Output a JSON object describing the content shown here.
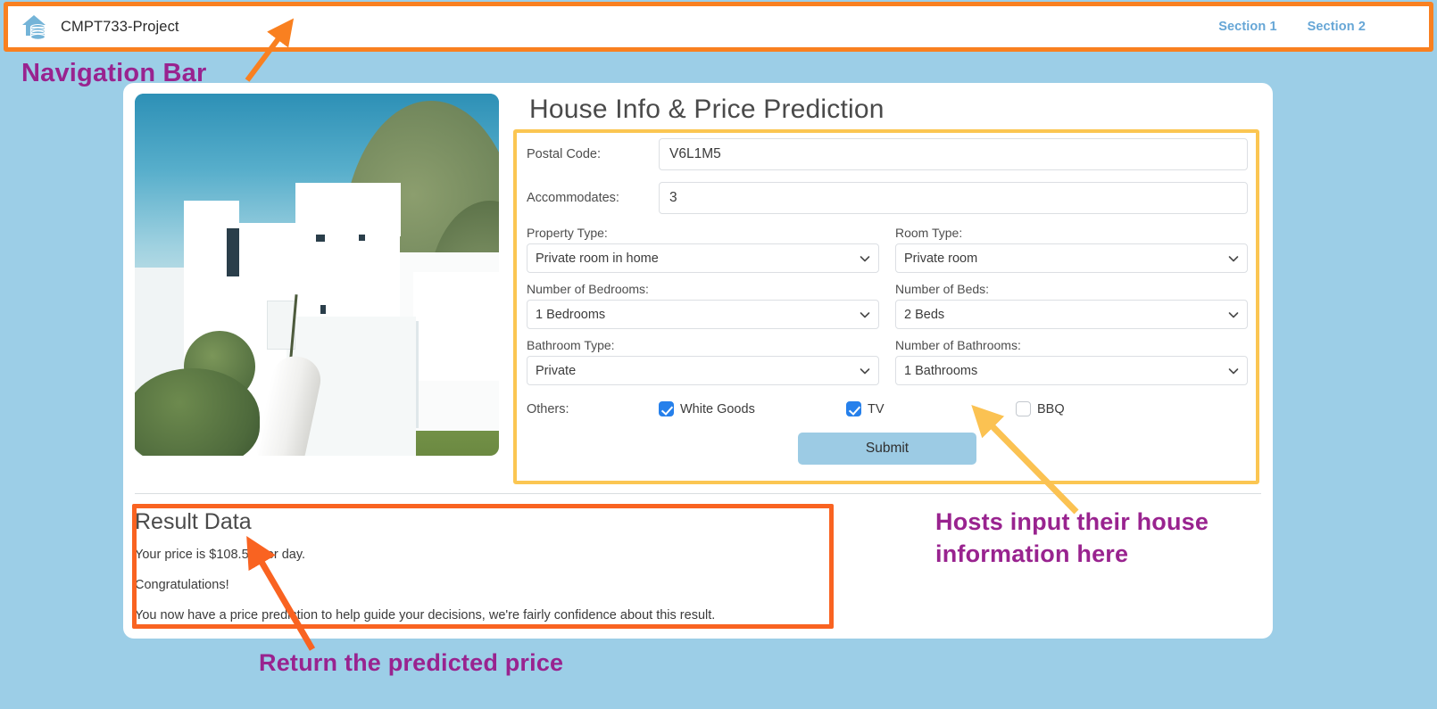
{
  "navbar": {
    "brand": "CMPT733-Project",
    "logo_icon": "house-coins-icon",
    "links": [
      {
        "label": "Section 1"
      },
      {
        "label": "Section 2"
      }
    ]
  },
  "main": {
    "photo_alt": "modern-white-house-photo",
    "form_title": "House Info & Price Prediction",
    "fields": {
      "postal_code": {
        "label": "Postal Code:",
        "value": "V6L1M5",
        "placeholder": ""
      },
      "accommodates": {
        "label": "Accommodates:",
        "value": "3",
        "placeholder": ""
      },
      "property_type": {
        "label": "Property Type:",
        "value": "Private room in home"
      },
      "room_type": {
        "label": "Room Type:",
        "value": "Private room"
      },
      "bedrooms": {
        "label": "Number of Bedrooms:",
        "value": "1 Bedrooms"
      },
      "beds": {
        "label": "Number of Beds:",
        "value": "2 Beds"
      },
      "bathroom_type": {
        "label": "Bathroom Type:",
        "value": "Private"
      },
      "bathrooms": {
        "label": "Number of Bathrooms:",
        "value": "1 Bathrooms"
      }
    },
    "others": {
      "label": "Others:",
      "checkboxes": [
        {
          "label": "White Goods",
          "checked": true
        },
        {
          "label": "TV",
          "checked": true
        },
        {
          "label": "BBQ",
          "checked": false
        }
      ]
    },
    "submit_label": "Submit"
  },
  "result": {
    "title": "Result Data",
    "price_line": "Your price is $108.56 per day.",
    "congrats_line": "Congratulations!",
    "detail_line": "You now have a price prediction to help guide your decisions, we're fairly confidence about this result."
  },
  "annotations": {
    "nav": "Navigation Bar",
    "hosts": "Hosts input their house information here",
    "result": "Return the predicted price"
  },
  "colors": {
    "page_background": "#9ccee7",
    "nav_box_outline": "#f98020",
    "form_box_outline": "#fbc652",
    "result_box_outline": "#f96321",
    "annotation_text": "#99238f",
    "nav_link": "#66a6d6",
    "submit_button": "#9ccbe4",
    "checkbox_checked": "#2680eb"
  }
}
